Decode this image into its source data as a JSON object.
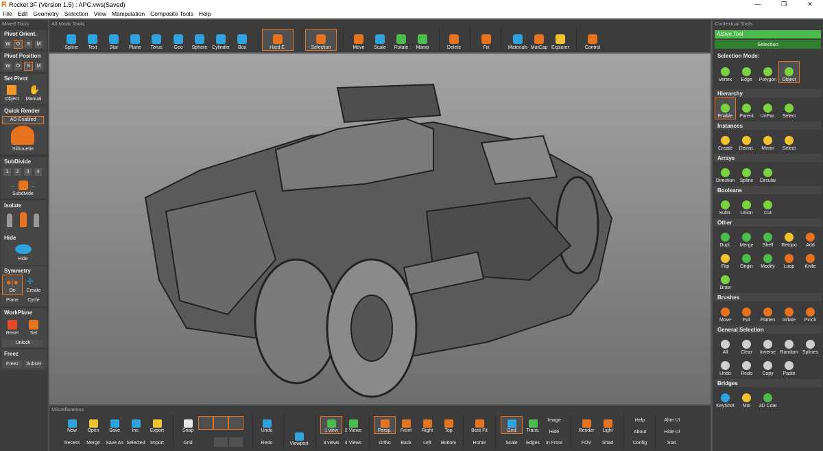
{
  "window": {
    "title": "Rocket 3F (Version 1.5) : APC.vws(Saved)",
    "min": "—",
    "max": "❐",
    "close": "✕"
  },
  "menu": [
    "File",
    "Edit",
    "Geometry",
    "Selection",
    "View",
    "Manipulation",
    "Composite Tools",
    "Help"
  ],
  "headers": {
    "left": "Mixed Tools",
    "top": "All Mods Tools",
    "right": "Contextual Tools",
    "bottom": "Miscellaneous"
  },
  "colors": {
    "accent": "#e8731f",
    "blue": "#2fa3e0",
    "green": "#4cbc4c",
    "yellow": "#f2c230",
    "red": "#e24a2a"
  },
  "left": {
    "pivot_orient": "Pivot Orient.",
    "pivot_position": "Pivot Position",
    "wosm": [
      "W",
      "O",
      "S",
      "M"
    ],
    "set_pivot": "Set Pivot",
    "set_pivot_btns": [
      "Object",
      "Manual"
    ],
    "quick_render": "Quick Render",
    "ao": "AO Enabled",
    "silhouette": "Silhouette",
    "subdivide": "SubDivide",
    "levels": [
      "1",
      "2",
      "3",
      "4"
    ],
    "subdivide_btn": "Subdivide",
    "isolate": "Isolate",
    "hide": "Hide",
    "hide_btn": "Hide",
    "symmetry": "Symmetry",
    "sym_btns": [
      "On",
      "Create"
    ],
    "sym_btns2": [
      "Plane",
      "Cycle"
    ],
    "workplane": "WorkPlane",
    "wp_btns": [
      "Reset",
      "Set"
    ],
    "unlock": "Unlock",
    "freez": "Freez",
    "freez_btns": [
      "Freez",
      "Subset"
    ]
  },
  "toolbar": [
    {
      "label": "Spline",
      "icon": "spline-icon"
    },
    {
      "label": "Text",
      "icon": "text-icon"
    },
    {
      "label": "Star",
      "icon": "star-icon"
    },
    {
      "label": "Plane",
      "icon": "plane-icon"
    },
    {
      "label": "Torus",
      "icon": "torus-icon"
    },
    {
      "label": "Geo",
      "icon": "geo-icon"
    },
    {
      "label": "Sphere",
      "icon": "sphere-icon"
    },
    {
      "label": "Cylinder",
      "icon": "cylinder-icon"
    },
    {
      "label": "Box",
      "icon": "box-icon"
    },
    {
      "label": "Hard E.",
      "icon": "hard-edge-icon"
    },
    {
      "label": "Selection",
      "icon": "selection-icon"
    },
    {
      "label": "Move",
      "icon": "move-icon"
    },
    {
      "label": "Scale",
      "icon": "scale-icon"
    },
    {
      "label": "Rotate",
      "icon": "rotate-icon"
    },
    {
      "label": "Manip",
      "icon": "manip-icon"
    },
    {
      "label": "Delete",
      "icon": "delete-icon"
    },
    {
      "label": "Fix",
      "icon": "fix-icon"
    },
    {
      "label": "Materials",
      "icon": "materials-icon"
    },
    {
      "label": "MatCap",
      "icon": "matcap-icon"
    },
    {
      "label": "Explorer",
      "icon": "explorer-icon"
    },
    {
      "label": "Control",
      "icon": "control-icon"
    }
  ],
  "right": {
    "active_tool": "Active Tool",
    "selection": "Selection",
    "selection_mode": "Selection Mode:",
    "modes": [
      "Vertex",
      "Edge",
      "Polygon",
      "Object"
    ],
    "hierarchy": "Hierarchy",
    "hier": [
      "Enable",
      "Parent",
      "UnPar.",
      "Select"
    ],
    "instances": "Instances",
    "inst": [
      "Create",
      "Deinst.",
      "Mirror",
      "Select"
    ],
    "arrays": "Arrays",
    "arr": [
      "Direction",
      "Spline",
      "Circular"
    ],
    "booleans": "Booleans",
    "bool": [
      "Subtr.",
      "Union",
      "Cut"
    ],
    "other": "Other",
    "other1": [
      "Dupl.",
      "Merge",
      "Shell",
      "Retopo",
      "Add"
    ],
    "other2": [
      "Flip",
      "Origin",
      "Modify",
      "Loop",
      "Knife"
    ],
    "other3": [
      "Draw"
    ],
    "brushes": "Brushes",
    "brush": [
      "Move",
      "Pull",
      "Flatten",
      "Inflate",
      "Pinch"
    ],
    "general": "General Selection",
    "gen1": [
      "All",
      "Clear",
      "Inverse",
      "Random",
      "Splines"
    ],
    "gen2": [
      "Undo",
      "Redo",
      "Copy",
      "Paste"
    ],
    "bridges": "Bridges",
    "bridge": [
      "KeyShot",
      "Moi",
      "3D Coat"
    ]
  },
  "bottom": {
    "file_top": [
      "New",
      "Open",
      "Save",
      "Inc.",
      "Export"
    ],
    "file_bot": [
      "Recent",
      "Merge",
      "Save As",
      "Selected",
      "Import"
    ],
    "snap": "Snap",
    "grid": "Grid",
    "undo": "Undo",
    "redo": "Redo",
    "viewport": "Viewport",
    "views_top": [
      "1 view",
      "2 Views"
    ],
    "views_bot": [
      "3 views",
      "4 Views"
    ],
    "cam_top": [
      "Persp.",
      "Front",
      "Right",
      "Top"
    ],
    "cam_bot": [
      "Ortho",
      "Back",
      "Left",
      "Bottom"
    ],
    "bestfit": "Best Fit",
    "home": "Home",
    "grid2": "Grid",
    "scale": "Scale",
    "trans": "Trans.",
    "edges": "Edges",
    "image": "Image",
    "hide": "Hide",
    "infront": "In Front",
    "render": "Render",
    "fov": "FOV",
    "light": "Light",
    "shad": "Shad",
    "help": "Help",
    "about": "About",
    "config": "Config",
    "alterui": "Alter UI",
    "hideui": "Hide UI",
    "stat": "Stat."
  }
}
